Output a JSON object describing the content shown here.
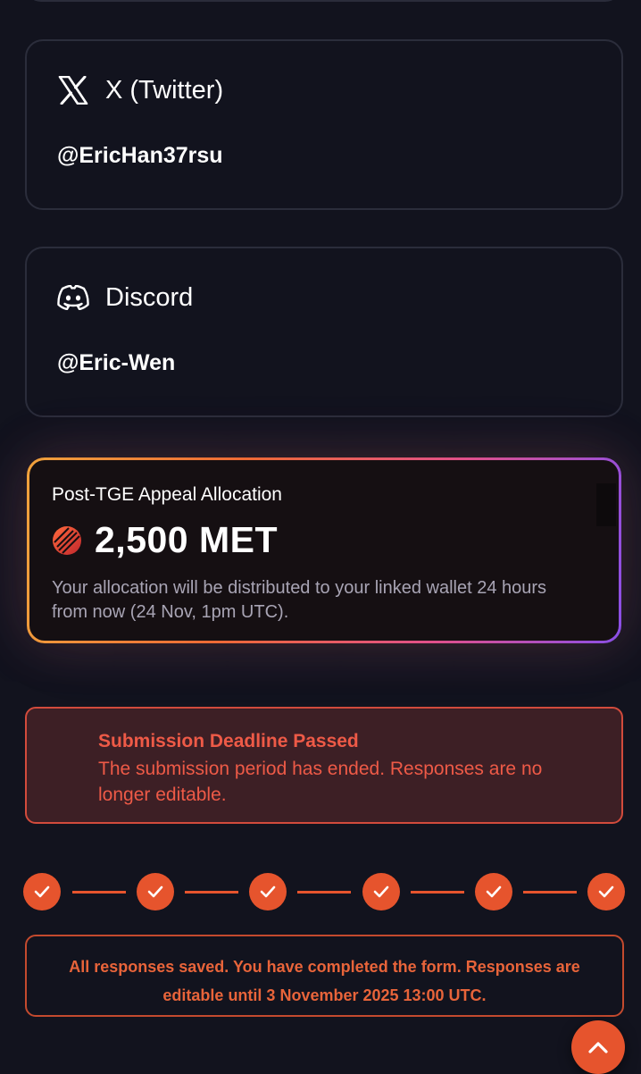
{
  "accounts": {
    "twitter": {
      "title": "X (Twitter)",
      "handle": "@EricHan37rsu",
      "icon": "x-logo-icon"
    },
    "discord": {
      "title": "Discord",
      "handle": "@Eric-Wen",
      "icon": "discord-logo-icon"
    }
  },
  "allocation": {
    "label": "Post-TGE Appeal Allocation",
    "amount": "2,500 MET",
    "note": "Your allocation will be distributed to your linked wallet 24 hours from now (24 Nov, 1pm UTC).",
    "icon": "met-token-icon"
  },
  "deadline": {
    "title": "Submission Deadline Passed",
    "body": "The submission period has ended. Responses are no longer editable."
  },
  "stepper": {
    "steps_total": 6,
    "steps_completed": 6
  },
  "saved_notice": {
    "text": "All responses saved. You have completed the form. Responses are editable until 3 November 2025 13:00 UTC."
  },
  "colors": {
    "background": "#12131e",
    "accent": "#e6542d",
    "error_text": "#ee5a47",
    "error_bg": "#3d1f25"
  }
}
